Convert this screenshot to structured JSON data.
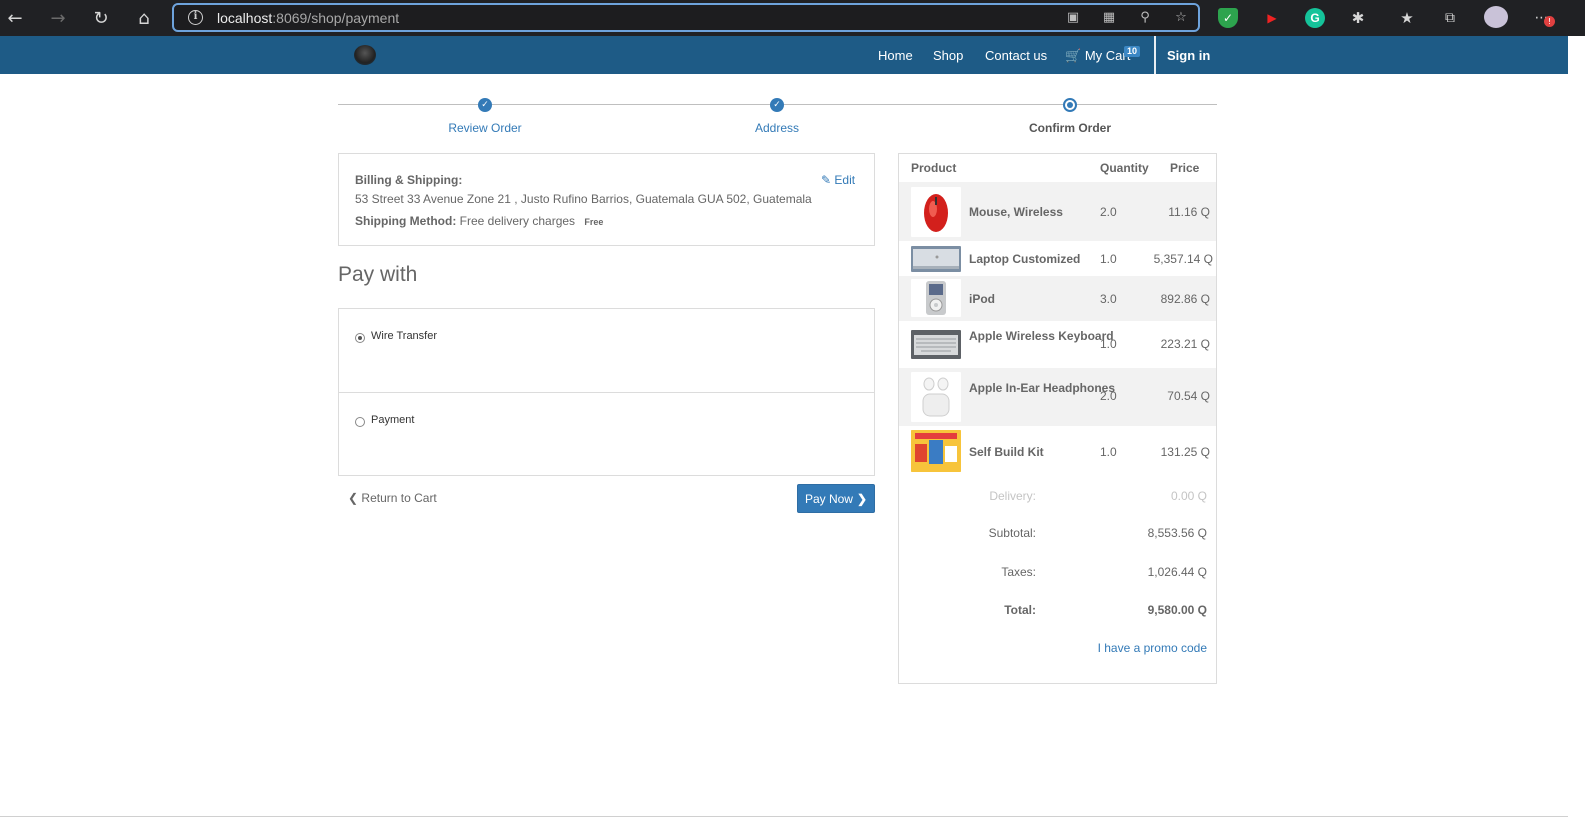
{
  "browser": {
    "url_host": "localhost",
    "url_rest": ":8069/shop/payment"
  },
  "navbar": {
    "links": [
      "Home",
      "Shop",
      "Contact us"
    ],
    "cart_label": "My Cart",
    "cart_count": "10",
    "signin": "Sign in"
  },
  "wizard": {
    "steps": [
      {
        "label": "Review Order",
        "state": "done"
      },
      {
        "label": "Address",
        "state": "done"
      },
      {
        "label": "Confirm Order",
        "state": "current"
      }
    ]
  },
  "billing": {
    "title": "Billing & Shipping:",
    "address": "53 Street 33 Avenue Zone 21 , Justo Rufino Barrios, Guatemala GUA 502, Guatemala",
    "shipping_label": "Shipping Method:",
    "shipping_value": "Free delivery charges",
    "shipping_badge": "Free",
    "edit": "Edit"
  },
  "payment": {
    "heading": "Pay with",
    "methods": [
      {
        "label": "Wire Transfer",
        "selected": true
      },
      {
        "label": "Payment",
        "selected": false
      }
    ],
    "return_label": "Return to Cart",
    "pay_label": "Pay Now"
  },
  "summary": {
    "headers": {
      "product": "Product",
      "quantity": "Quantity",
      "price": "Price"
    },
    "items": [
      {
        "name": "Mouse, Wireless",
        "qty": "2.0",
        "price": "11.16 Q",
        "icon": "mouse-thumbnail"
      },
      {
        "name": "Laptop Customized",
        "qty": "1.0",
        "price": "5,357.14 Q",
        "icon": "laptop-thumbnail"
      },
      {
        "name": "iPod",
        "qty": "3.0",
        "price": "892.86 Q",
        "icon": "ipod-thumbnail"
      },
      {
        "name": "Apple Wireless Keyboard",
        "qty": "1.0",
        "price": "223.21 Q",
        "icon": "keyboard-thumbnail"
      },
      {
        "name": "Apple In-Ear Headphones",
        "qty": "2.0",
        "price": "70.54 Q",
        "icon": "headphones-thumbnail"
      },
      {
        "name": "Self Build Kit",
        "qty": "1.0",
        "price": "131.25 Q",
        "icon": "kit-thumbnail"
      }
    ],
    "delivery_label": "Delivery:",
    "delivery_value": "0.00 Q",
    "subtotal_label": "Subtotal:",
    "subtotal_value": "8,553.56 Q",
    "taxes_label": "Taxes:",
    "taxes_value": "1,026.44 Q",
    "total_label": "Total:",
    "total_value": "9,580.00 Q",
    "promo": "I have a promo code"
  },
  "colors": {
    "navbar": "#1e5b86",
    "accent": "#337ab7"
  }
}
